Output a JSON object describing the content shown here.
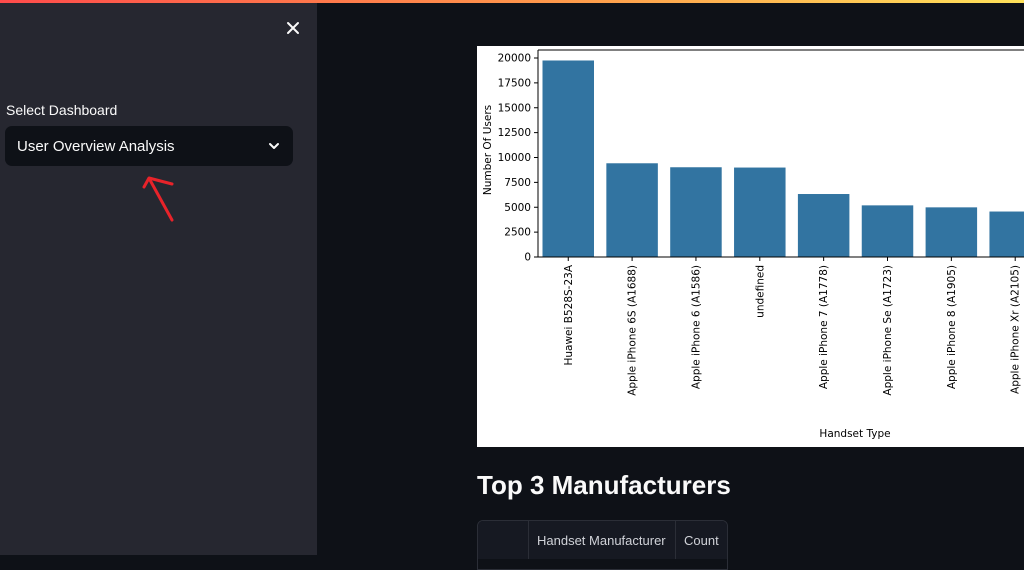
{
  "sidebar": {
    "close_icon": "close-icon",
    "select_label": "Select Dashboard",
    "select_value": "User Overview Analysis",
    "select_icon": "chevron-down-icon"
  },
  "chart_data": {
    "type": "bar",
    "categories": [
      "Huawei B528S-23A",
      "Apple iPhone 6S (A1688)",
      "Apple iPhone 6 (A1586)",
      "undefined",
      "Apple iPhone 7 (A1778)",
      "Apple iPhone Se (A1723)",
      "Apple iPhone 8 (A1905)",
      "Apple iPhone Xr (A2105)"
    ],
    "values": [
      19750,
      9420,
      9020,
      8990,
      6330,
      5190,
      4990,
      4570
    ],
    "xlabel": "Handset Type",
    "ylabel": "Number Of Users",
    "ylim": [
      0,
      20000
    ],
    "yticks": [
      0,
      2500,
      5000,
      7500,
      10000,
      12500,
      15000,
      17500,
      20000
    ],
    "bar_color": "#3274a1",
    "grid": false
  },
  "main": {
    "section_title": "Top 3 Manufacturers",
    "table": {
      "columns": [
        "",
        "Handset Manufacturer",
        "Count"
      ]
    }
  },
  "colors": {
    "background": "#0e1117",
    "sidebar": "#262730",
    "annotation": "#e8232a"
  }
}
